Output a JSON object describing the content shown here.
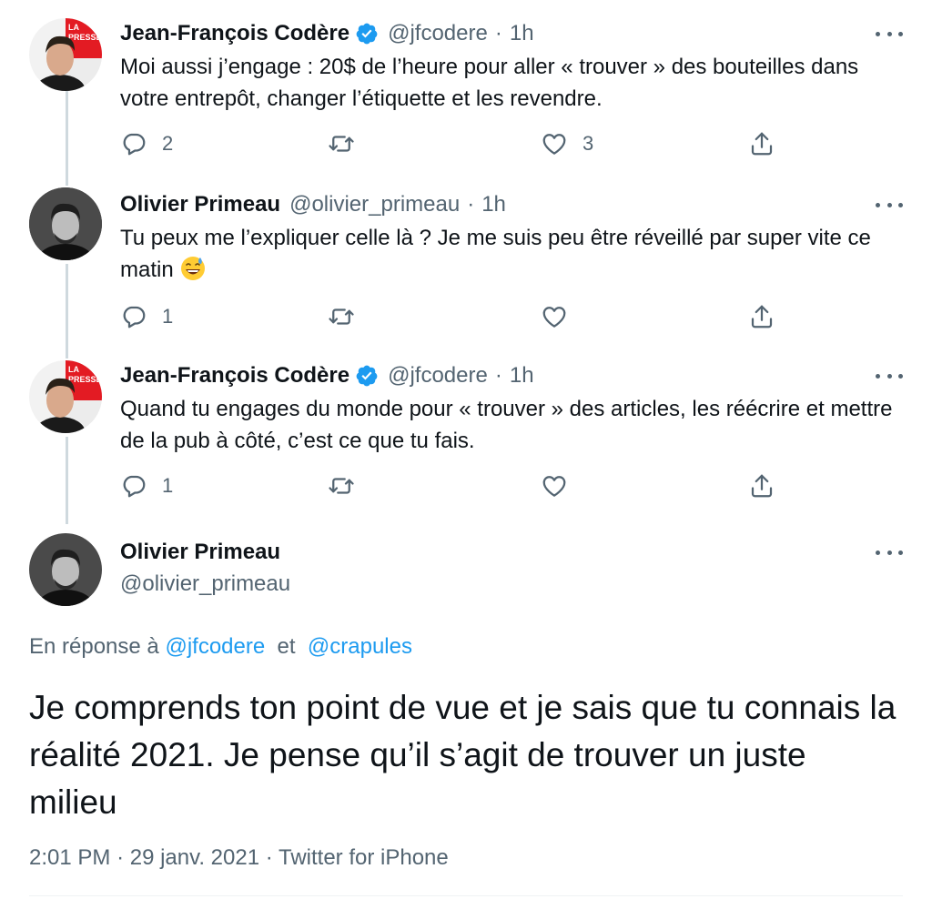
{
  "replies": [
    {
      "author_name": "Jean-François Codère",
      "verified": true,
      "handle": "@jfcodere",
      "separator": "·",
      "time": "1h",
      "text": "Moi aussi j’engage : 20$ de l’heure pour aller « trouver » des bouteilles dans votre entrepôt, changer l’étiquette et les revendre.",
      "reply_count": "2",
      "like_count": "3",
      "avatar_badge": [
        "LA",
        "PRESSE"
      ]
    },
    {
      "author_name": "Olivier Primeau",
      "verified": false,
      "handle": "@olivier_primeau",
      "separator": "·",
      "time": "1h",
      "text": "Tu peux me l’expliquer celle là ? Je me suis peu être réveillé par super vite ce matin",
      "emoji": "grinning-face-with-sweat",
      "reply_count": "1",
      "like_count": ""
    },
    {
      "author_name": "Jean-François Codère",
      "verified": true,
      "handle": "@jfcodere",
      "separator": "·",
      "time": "1h",
      "text": "Quand tu engages du monde pour « trouver » des articles, les réécrire et mettre de la pub à côté, c’est ce que tu fais.",
      "reply_count": "1",
      "like_count": "",
      "avatar_badge": [
        "LA",
        "PRESSE"
      ]
    }
  ],
  "main_tweet": {
    "author_name": "Olivier Primeau",
    "handle": "@olivier_primeau",
    "reply_prefix": "En réponse à",
    "reply_to_1": "@jfcodere",
    "reply_joiner": "et",
    "reply_to_2": "@crapules",
    "text": "Je comprends ton point de vue et je sais que tu connais la réalité 2021. Je pense qu’il s’agit de trouver un juste milieu",
    "time": "2:01 PM",
    "separator": "·",
    "date": "29 janv. 2021",
    "source": "Twitter for iPhone"
  },
  "colors": {
    "accent": "#1d9bf0",
    "secondary_text": "#536471",
    "primary_text": "#0f1419",
    "thread_line": "#cfd9de",
    "badge_red": "#e31b23"
  },
  "icons": [
    "reply-icon",
    "retweet-icon",
    "like-icon",
    "share-icon",
    "more-icon",
    "verified-badge-icon"
  ]
}
